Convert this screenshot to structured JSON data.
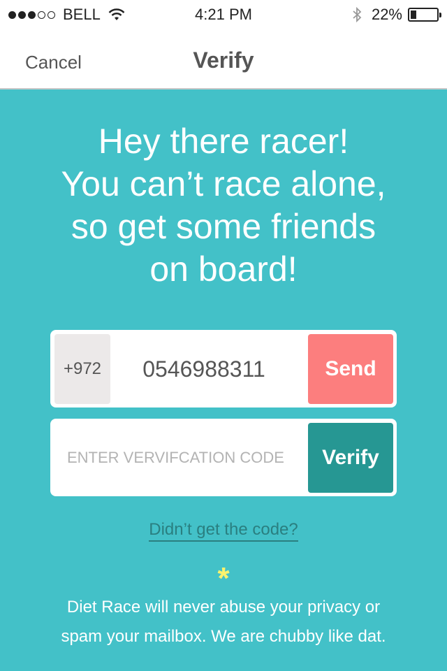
{
  "status_bar": {
    "carrier": "BELL",
    "time": "4:21 PM",
    "battery_text": "22%",
    "battery_level": 0.22
  },
  "nav": {
    "cancel_label": "Cancel",
    "title": "Verify"
  },
  "headline": {
    "lines": [
      "Hey there racer!",
      "You can’t race alone,",
      "so get some friends",
      "on board!"
    ]
  },
  "phone": {
    "country_code": "+972",
    "number": "0546988311",
    "send_label": "Send",
    "send_color": "#fc7e7e"
  },
  "verification": {
    "placeholder": "ENTER VERVIFCATION CODE",
    "verify_label": "Verify",
    "verify_color": "#269793"
  },
  "resend_label": "Didn’t get the code?",
  "footer": {
    "asterisk": "*",
    "lines": [
      "Diet Race will never abuse your privacy or",
      "spam your mailbox. We are chubby like dat."
    ]
  },
  "colors": {
    "background": "#43c1c8",
    "accent_yellow": "#fbf36e"
  }
}
